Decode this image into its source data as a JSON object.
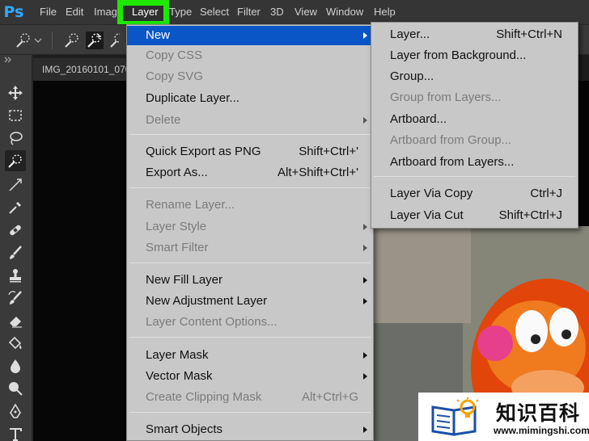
{
  "app": {
    "logo": "Ps"
  },
  "menubar": {
    "items": [
      "File",
      "Edit",
      "Image",
      "Layer",
      "Type",
      "Select",
      "Filter",
      "3D",
      "View",
      "Window",
      "Help"
    ]
  },
  "document": {
    "tab_title": "IMG_20160101_070"
  },
  "layer_menu": {
    "items": [
      {
        "label": "New",
        "shortcut": "",
        "submenu": true,
        "disabled": false,
        "highlighted": true
      },
      {
        "label": "Copy CSS",
        "shortcut": "",
        "submenu": false,
        "disabled": true
      },
      {
        "label": "Copy SVG",
        "shortcut": "",
        "submenu": false,
        "disabled": true
      },
      {
        "label": "Duplicate Layer...",
        "shortcut": "",
        "submenu": false,
        "disabled": false
      },
      {
        "label": "Delete",
        "shortcut": "",
        "submenu": true,
        "disabled": true
      },
      {
        "label": "Quick Export as PNG",
        "shortcut": "Shift+Ctrl+'",
        "submenu": false,
        "disabled": false
      },
      {
        "label": "Export As...",
        "shortcut": "Alt+Shift+Ctrl+'",
        "submenu": false,
        "disabled": false
      },
      {
        "label": "Rename Layer...",
        "shortcut": "",
        "submenu": false,
        "disabled": true
      },
      {
        "label": "Layer Style",
        "shortcut": "",
        "submenu": true,
        "disabled": true
      },
      {
        "label": "Smart Filter",
        "shortcut": "",
        "submenu": true,
        "disabled": true
      },
      {
        "label": "New Fill Layer",
        "shortcut": "",
        "submenu": true,
        "disabled": false
      },
      {
        "label": "New Adjustment Layer",
        "shortcut": "",
        "submenu": true,
        "disabled": false
      },
      {
        "label": "Layer Content Options...",
        "shortcut": "",
        "submenu": false,
        "disabled": true
      },
      {
        "label": "Layer Mask",
        "shortcut": "",
        "submenu": true,
        "disabled": false
      },
      {
        "label": "Vector Mask",
        "shortcut": "",
        "submenu": true,
        "disabled": false
      },
      {
        "label": "Create Clipping Mask",
        "shortcut": "Alt+Ctrl+G",
        "submenu": false,
        "disabled": true
      },
      {
        "label": "Smart Objects",
        "shortcut": "",
        "submenu": true,
        "disabled": false
      }
    ]
  },
  "new_submenu": {
    "items": [
      {
        "label": "Layer...",
        "shortcut": "Shift+Ctrl+N",
        "disabled": false
      },
      {
        "label": "Layer from Background...",
        "shortcut": "",
        "disabled": false
      },
      {
        "label": "Group...",
        "shortcut": "",
        "disabled": false
      },
      {
        "label": "Group from Layers...",
        "shortcut": "",
        "disabled": true
      },
      {
        "label": "Artboard...",
        "shortcut": "",
        "disabled": false
      },
      {
        "label": "Artboard from Group...",
        "shortcut": "",
        "disabled": true
      },
      {
        "label": "Artboard from Layers...",
        "shortcut": "",
        "disabled": false
      },
      {
        "label": "Layer Via Copy",
        "shortcut": "Ctrl+J",
        "disabled": false
      },
      {
        "label": "Layer Via Cut",
        "shortcut": "Shift+Ctrl+J",
        "disabled": false
      }
    ]
  },
  "watermark": {
    "text": "知识百科",
    "url": "www.mimingshi.com"
  },
  "colors": {
    "highlight": "#0b56c7",
    "menu_bg": "#c8c8c8",
    "callout": "#1ee800",
    "ps_blue": "#31a8ff"
  },
  "icons": [
    "move-icon",
    "marquee-icon",
    "lasso-icon",
    "quick-selection-icon",
    "crop-icon",
    "eyedropper-icon",
    "healing-brush-icon",
    "brush-icon",
    "clone-stamp-icon",
    "history-brush-icon",
    "eraser-icon",
    "paint-bucket-icon",
    "blur-icon",
    "dodge-icon",
    "pen-icon",
    "type-icon"
  ]
}
